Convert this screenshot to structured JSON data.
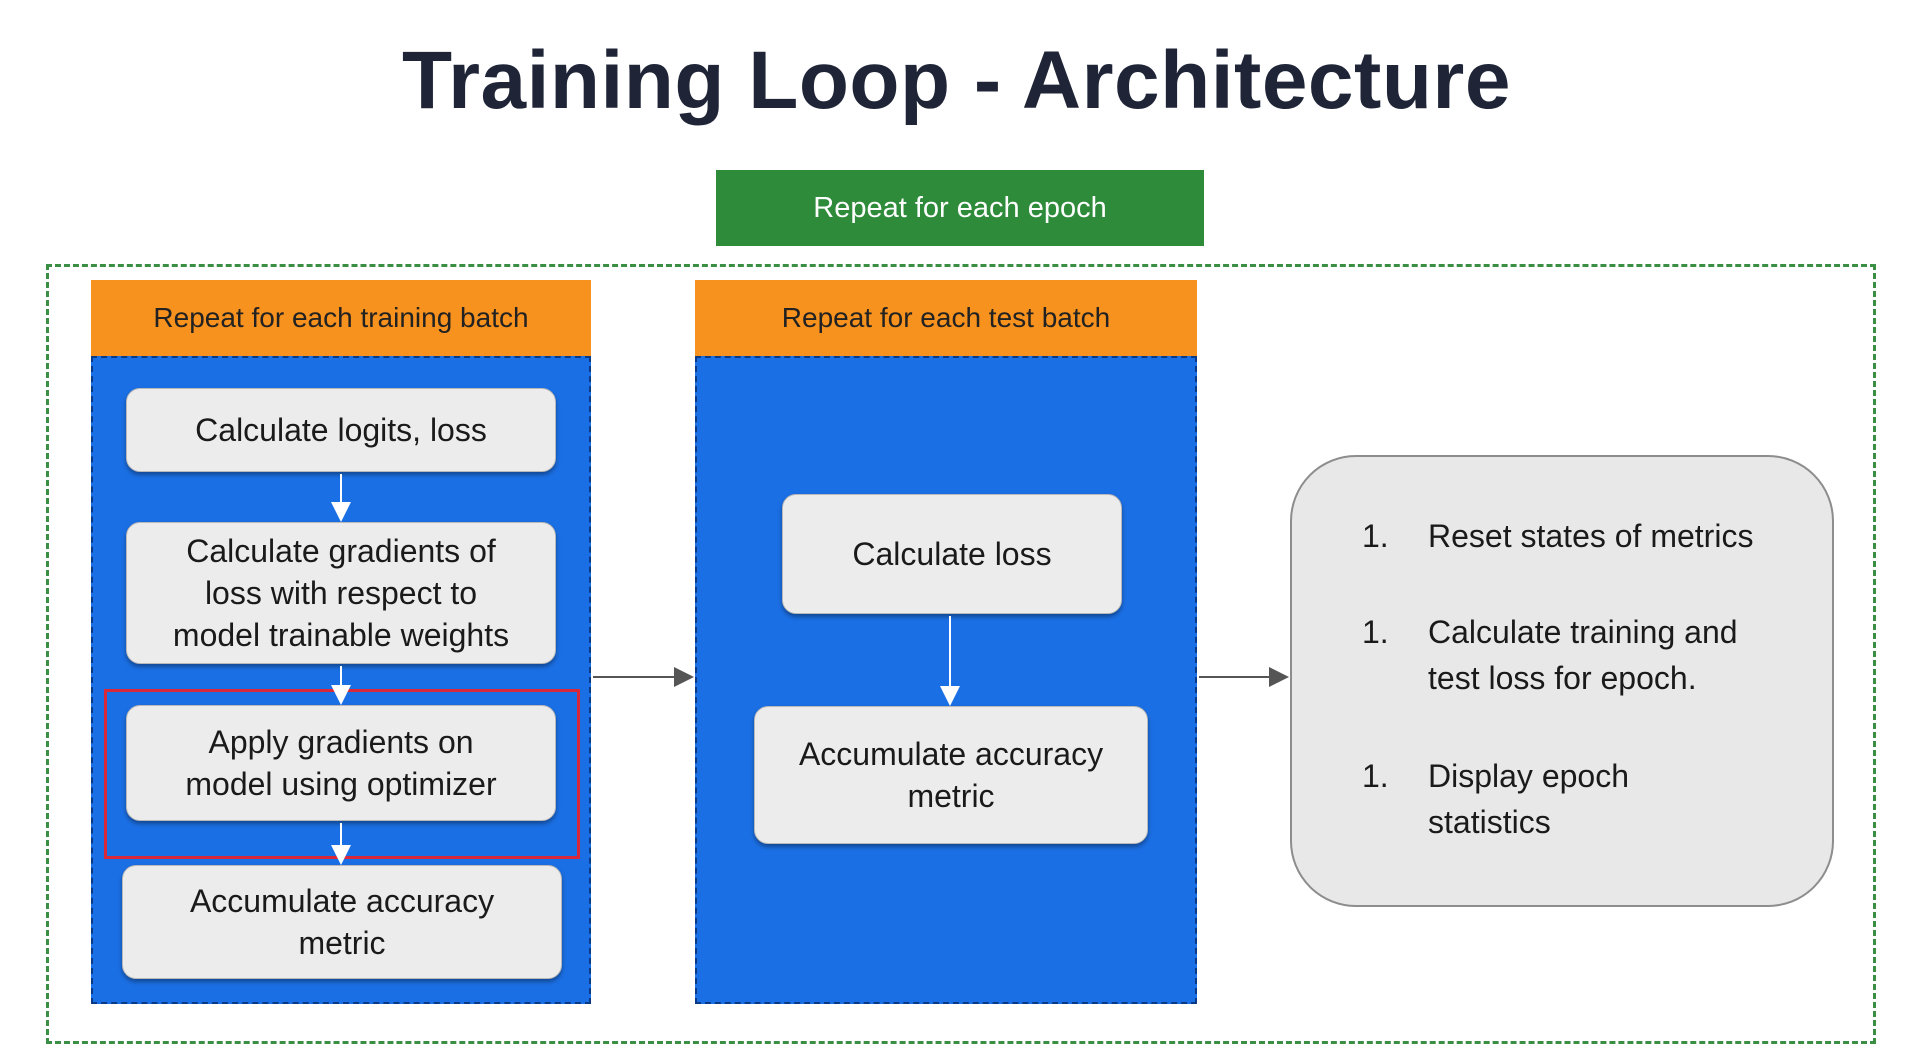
{
  "title": "Training Loop - Architecture",
  "epoch_loop": {
    "label": "Repeat for each epoch",
    "color": "#2e8b3a"
  },
  "training_panel": {
    "header": "Repeat for each training batch",
    "steps": [
      "Calculate logits, loss",
      "Calculate gradients of\nloss with respect to\nmodel trainable weights",
      "Apply gradients on\nmodel using optimizer",
      "Accumulate accuracy\nmetric"
    ],
    "highlighted_step_index": 2
  },
  "test_panel": {
    "header": "Repeat for each test batch",
    "steps": [
      "Calculate loss",
      "Accumulate accuracy\nmetric"
    ]
  },
  "epoch_summary": {
    "items": [
      {
        "number": "1.",
        "text": "Reset states of metrics"
      },
      {
        "number": "1.",
        "text": "Calculate training and\ntest loss for epoch."
      },
      {
        "number": "1.",
        "text": "Display epoch\nstatistics"
      }
    ]
  },
  "colors": {
    "header": "#f7921e",
    "panel": "#1b6fe4",
    "step_box": "#ececec",
    "highlight": "#d9283a",
    "title": "#1f2537"
  }
}
